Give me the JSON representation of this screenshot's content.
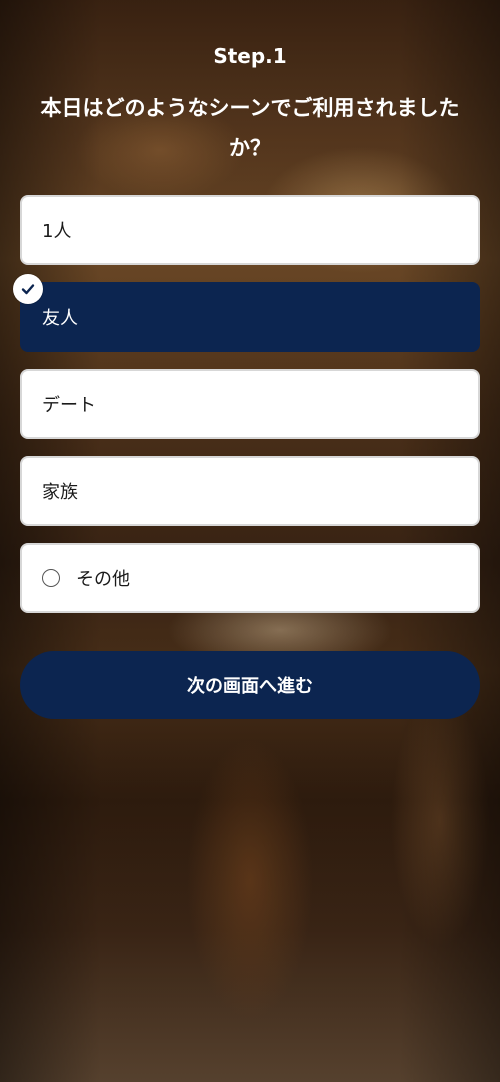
{
  "header": {
    "step": "Step.1",
    "question": "本日はどのようなシーンでご利用されましたか？"
  },
  "options": [
    {
      "label": "1人",
      "selected": false
    },
    {
      "label": "友人",
      "selected": true
    },
    {
      "label": "デート",
      "selected": false
    },
    {
      "label": "家族",
      "selected": false
    },
    {
      "label": "その他",
      "selected": false,
      "type": "radio"
    }
  ],
  "next_button": {
    "label": "次の画面へ進む"
  },
  "icons": {
    "selected_badge": "check-icon",
    "other_option": "radio-circle-icon"
  },
  "colors": {
    "primary": "#0c2550",
    "option_bg": "#ffffff",
    "option_border": "#d7d7d7",
    "text_on_primary": "#ffffff"
  }
}
